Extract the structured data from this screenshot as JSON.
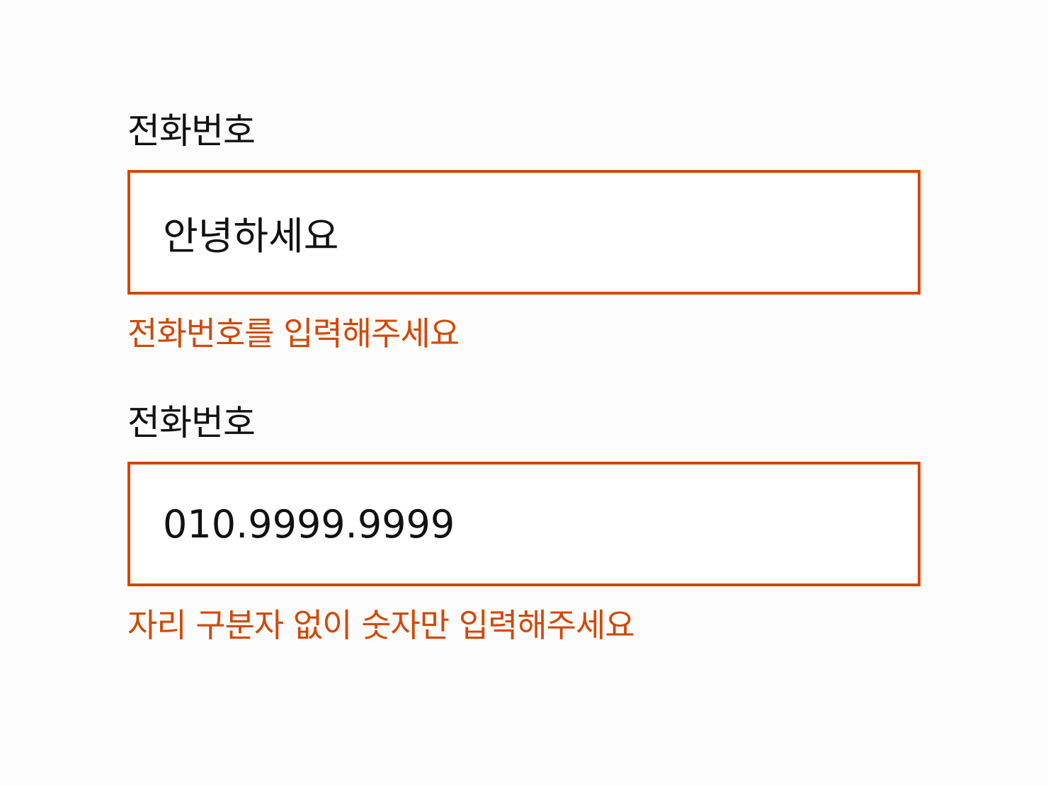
{
  "colors": {
    "error": "#D14905",
    "label": "#111111",
    "background": "#fcfcfc"
  },
  "fields": [
    {
      "label": "전화번호",
      "value": "안녕하세요",
      "error": "전화번호를 입력해주세요"
    },
    {
      "label": "전화번호",
      "value": "010.9999.9999",
      "error": "자리 구분자 없이 숫자만 입력해주세요"
    }
  ]
}
